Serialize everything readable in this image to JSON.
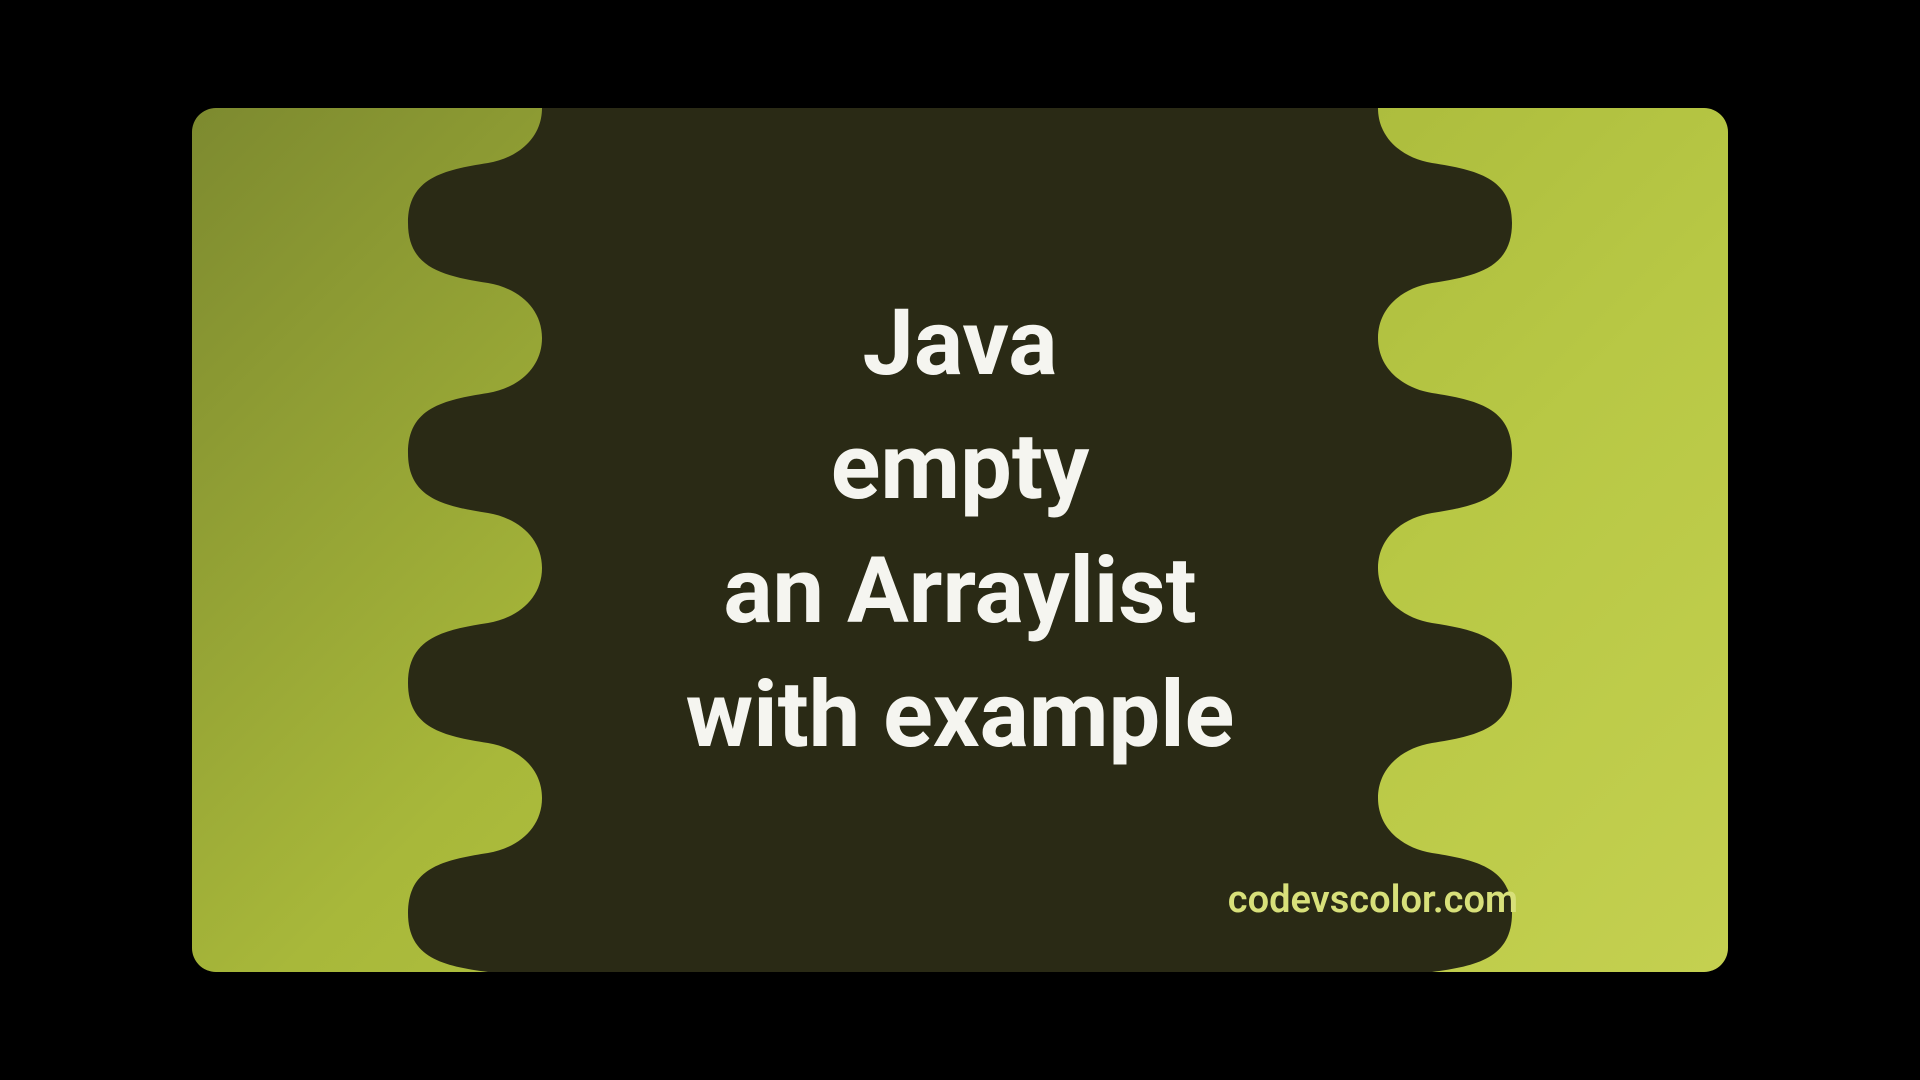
{
  "title": {
    "line1": "Java",
    "line2": "empty",
    "line3": "an Arraylist",
    "line4": "with example"
  },
  "watermark": "codevscolor.com",
  "colors": {
    "blob": "#2a2a15",
    "gradient_start": "#7d8a2f",
    "gradient_end": "#c4d050",
    "text": "#f5f5f0",
    "watermark": "#d8e07a"
  }
}
